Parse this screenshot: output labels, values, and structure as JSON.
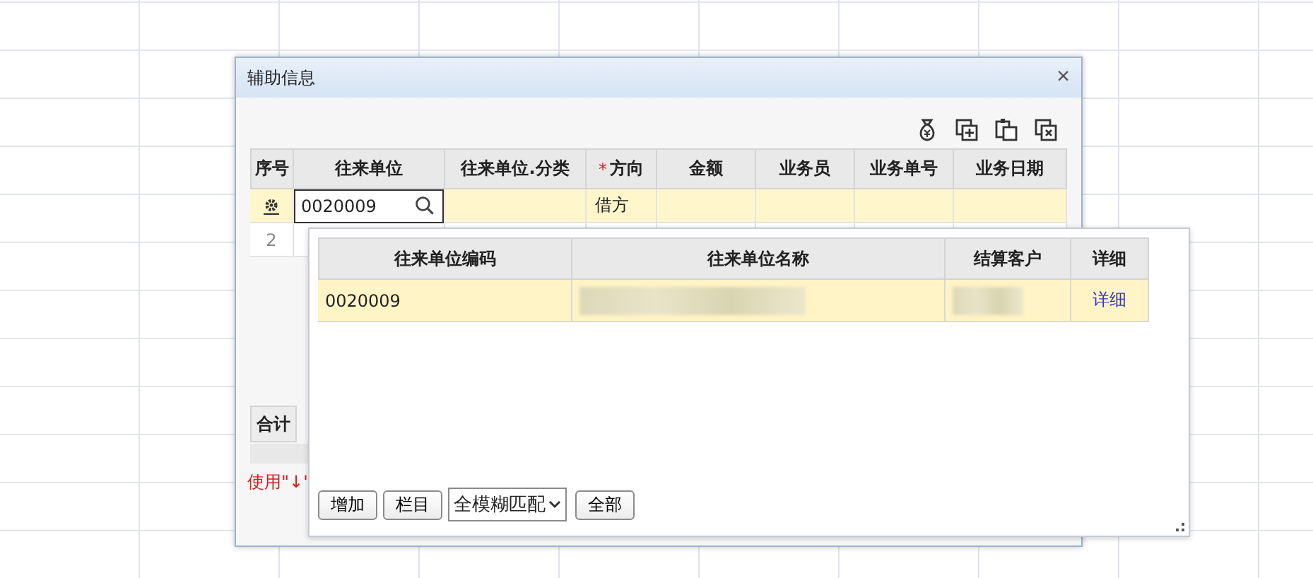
{
  "dialog": {
    "title": "辅助信息",
    "close": "×"
  },
  "grid": {
    "columns": [
      {
        "label": "序号"
      },
      {
        "label": "往来单位"
      },
      {
        "label": "往来单位.分类"
      },
      {
        "label": "方向",
        "required_mark": "*"
      },
      {
        "label": "金额"
      },
      {
        "label": "业务员"
      },
      {
        "label": "业务单号"
      },
      {
        "label": "业务日期"
      }
    ],
    "rows": [
      {
        "number": "",
        "selected": true,
        "unit_value": "0020009",
        "direction": "借方"
      },
      {
        "number": "2",
        "selected": false,
        "unit_value": "",
        "direction": ""
      }
    ],
    "total_label": "合计",
    "hint": "使用\"↓\""
  },
  "lookup": {
    "columns": [
      "往来单位编码",
      "往来单位名称",
      "结算客户",
      "详细"
    ],
    "rows": [
      {
        "code": "0020009",
        "name_redacted": true,
        "customer_redacted": true,
        "detail": "详细",
        "selected": true
      }
    ],
    "buttons": [
      "增加",
      "栏目"
    ],
    "match_mode": "全模糊匹配",
    "all_button": "全部"
  }
}
